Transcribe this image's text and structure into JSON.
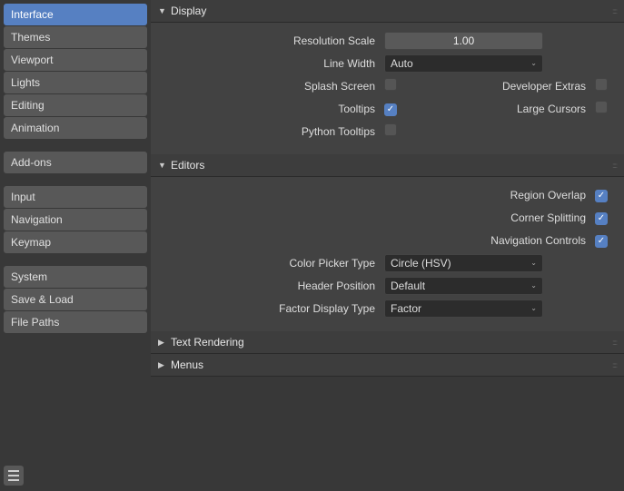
{
  "sidebar": {
    "groups": [
      [
        {
          "label": "Interface",
          "active": true
        },
        {
          "label": "Themes"
        },
        {
          "label": "Viewport"
        },
        {
          "label": "Lights"
        },
        {
          "label": "Editing"
        },
        {
          "label": "Animation"
        }
      ],
      [
        {
          "label": "Add-ons"
        }
      ],
      [
        {
          "label": "Input"
        },
        {
          "label": "Navigation"
        },
        {
          "label": "Keymap"
        }
      ],
      [
        {
          "label": "System"
        },
        {
          "label": "Save & Load"
        },
        {
          "label": "File Paths"
        }
      ]
    ]
  },
  "panels": {
    "display": {
      "title": "Display",
      "expanded": true,
      "resolution_scale_label": "Resolution Scale",
      "resolution_scale_value": "1.00",
      "line_width_label": "Line Width",
      "line_width_value": "Auto",
      "splash_label": "Splash Screen",
      "splash_checked": false,
      "dev_extras_label": "Developer Extras",
      "dev_extras_checked": false,
      "tooltips_label": "Tooltips",
      "tooltips_checked": true,
      "large_cursors_label": "Large Cursors",
      "large_cursors_checked": false,
      "python_tooltips_label": "Python Tooltips",
      "python_tooltips_checked": false
    },
    "editors": {
      "title": "Editors",
      "expanded": true,
      "region_overlap_label": "Region Overlap",
      "region_overlap_checked": true,
      "corner_splitting_label": "Corner Splitting",
      "corner_splitting_checked": true,
      "nav_controls_label": "Navigation Controls",
      "nav_controls_checked": true,
      "color_picker_label": "Color Picker Type",
      "color_picker_value": "Circle (HSV)",
      "header_pos_label": "Header Position",
      "header_pos_value": "Default",
      "factor_display_label": "Factor Display Type",
      "factor_display_value": "Factor"
    },
    "text_rendering": {
      "title": "Text Rendering",
      "expanded": false
    },
    "menus": {
      "title": "Menus",
      "expanded": false
    }
  }
}
